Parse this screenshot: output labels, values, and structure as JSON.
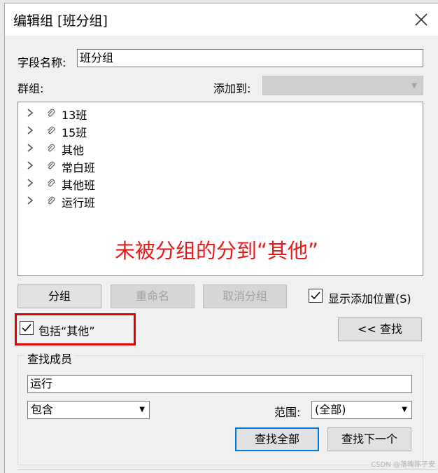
{
  "dialog": {
    "title": "编辑组 [班分组]",
    "field_name_label": "字段名称:",
    "field_name_value": "班分组",
    "groups_label": "群组:",
    "add_to_label": "添加到:",
    "tree_items": [
      "13班",
      "15班",
      "其他",
      "常白班",
      "其他班",
      "运行班"
    ],
    "annotation": "未被分组的分到“其他”",
    "buttons": {
      "group": "分组",
      "rename": "重命名",
      "ungroup": "取消分组",
      "find": "<< 查找",
      "find_all": "查找全部",
      "find_next": "查找下一个"
    },
    "show_add_position": {
      "label": "显示添加位置(S)",
      "checked": true
    },
    "include_other": {
      "label": "包括“其他”",
      "checked": true
    },
    "find_members": {
      "legend": "查找成员",
      "search_value": "运行",
      "match_mode": "包含",
      "range_label": "范围:",
      "range_value": "(全部)"
    },
    "watermark": "CSDN @落魄陈子安"
  }
}
